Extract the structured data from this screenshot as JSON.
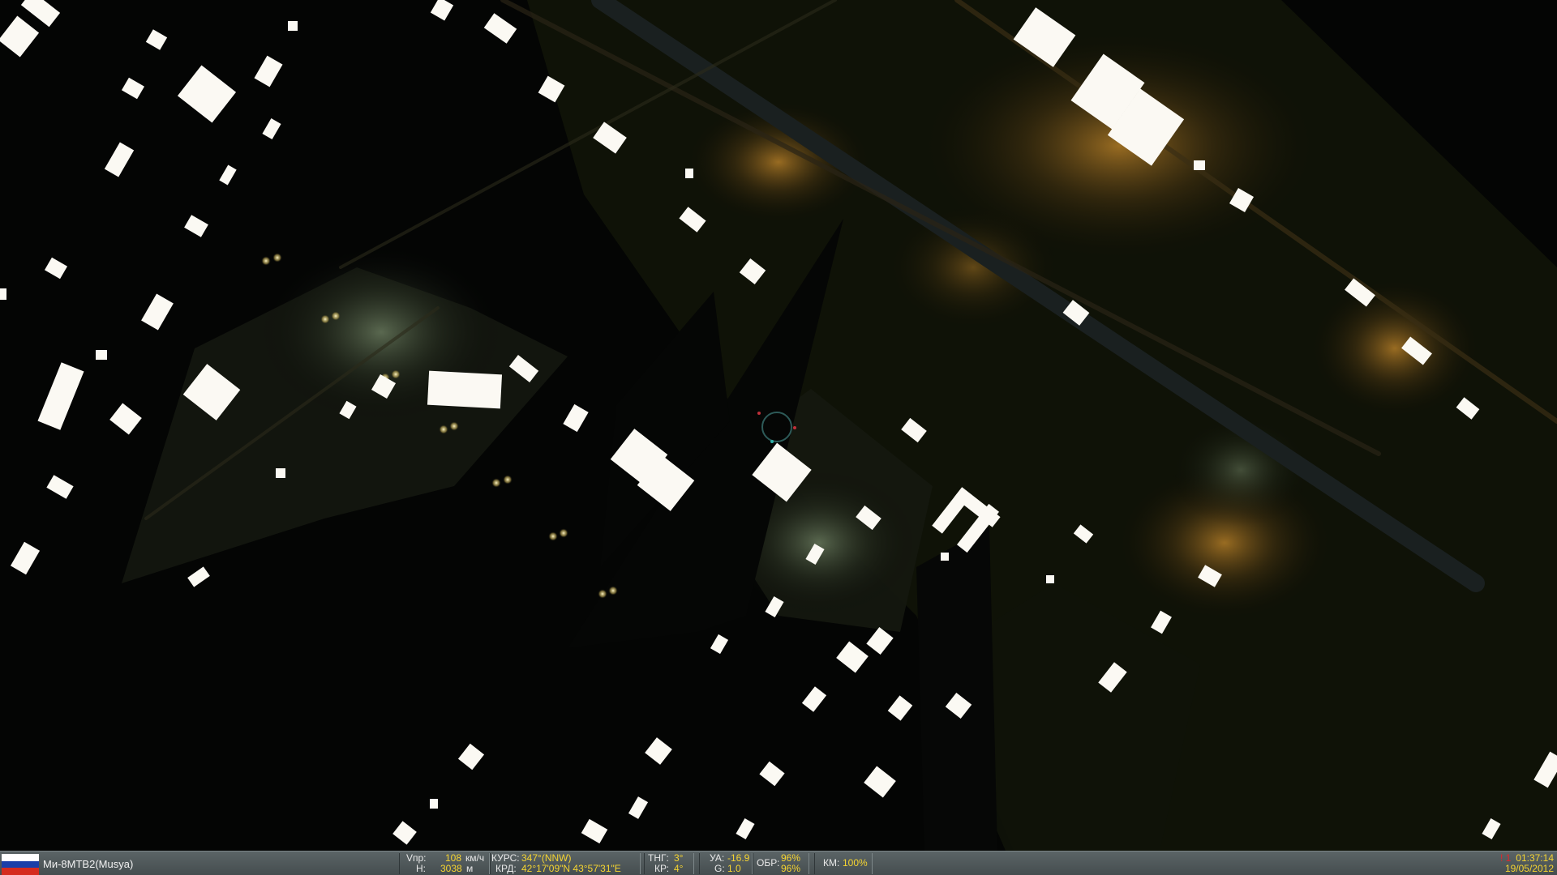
{
  "unit": {
    "name": "Ми-8МТВ2(Musya)",
    "flag": "russia-flag"
  },
  "hud": {
    "speed": {
      "label": "Vпр:",
      "value": "108",
      "unit": "км/ч"
    },
    "altitude": {
      "label": "H:",
      "value": "3038",
      "unit": "м"
    },
    "heading": {
      "label": "КУРС:",
      "value": "347°(NNW)"
    },
    "coords": {
      "label": "КРД:",
      "value": "42°17'09\"N 43°57'31\"E"
    },
    "pitch": {
      "label": "ТНГ:",
      "value": "3°"
    },
    "roll": {
      "label": "КР:",
      "value": "4°"
    },
    "aoa": {
      "label": "УА:",
      "value": "-16.9"
    },
    "gload": {
      "label": "G:",
      "value": "1.0"
    },
    "rpm": {
      "label": "ОБР:",
      "value1": "96%",
      "value2": "96%"
    },
    "fuel": {
      "label": "КМ:",
      "value": "100%"
    }
  },
  "clock": {
    "time": "01:37:14",
    "date": "19/05/2012",
    "warning": "!  1"
  },
  "colors": {
    "hud_value": "#f5d431",
    "building": "#fbf9f3",
    "bar_bg": "#4f585a"
  }
}
